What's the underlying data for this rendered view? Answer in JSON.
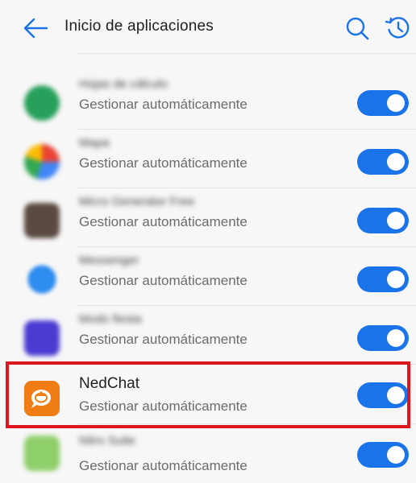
{
  "header": {
    "title": "Inicio de aplicaciones",
    "back_icon": "arrow-left-icon",
    "search_icon": "search-icon",
    "history_icon": "history-icon",
    "accent": "#1a73e8"
  },
  "apps": [
    {
      "name": "Hojas de cálculo",
      "subtitle": "Gestionar automáticamente",
      "enabled": true,
      "icon_color": "#26a05a",
      "blurred": true
    },
    {
      "name": "Mapa",
      "subtitle": "Gestionar automáticamente",
      "enabled": true,
      "icon_color": "#3ea854",
      "blurred": true
    },
    {
      "name": "Micro Generator Free",
      "subtitle": "Gestionar automáticamente",
      "enabled": true,
      "icon_color": "#5a4a42",
      "blurred": true
    },
    {
      "name": "Messenger",
      "subtitle": "Gestionar automáticamente",
      "enabled": true,
      "icon_color": "#2d8cf0",
      "blurred": true
    },
    {
      "name": "Modo fiesta",
      "subtitle": "Gestionar automáticamente",
      "enabled": true,
      "icon_color": "#4a3bd1",
      "blurred": true
    },
    {
      "name": "NedChat",
      "subtitle": "Gestionar automáticamente",
      "enabled": true,
      "icon_color": "#f07c16",
      "blurred": false,
      "highlighted": true
    },
    {
      "name": "Nitro Suite",
      "subtitle": "Gestionar automáticamente",
      "enabled": true,
      "icon_color": "#8fcf6a",
      "blurred": true
    }
  ]
}
